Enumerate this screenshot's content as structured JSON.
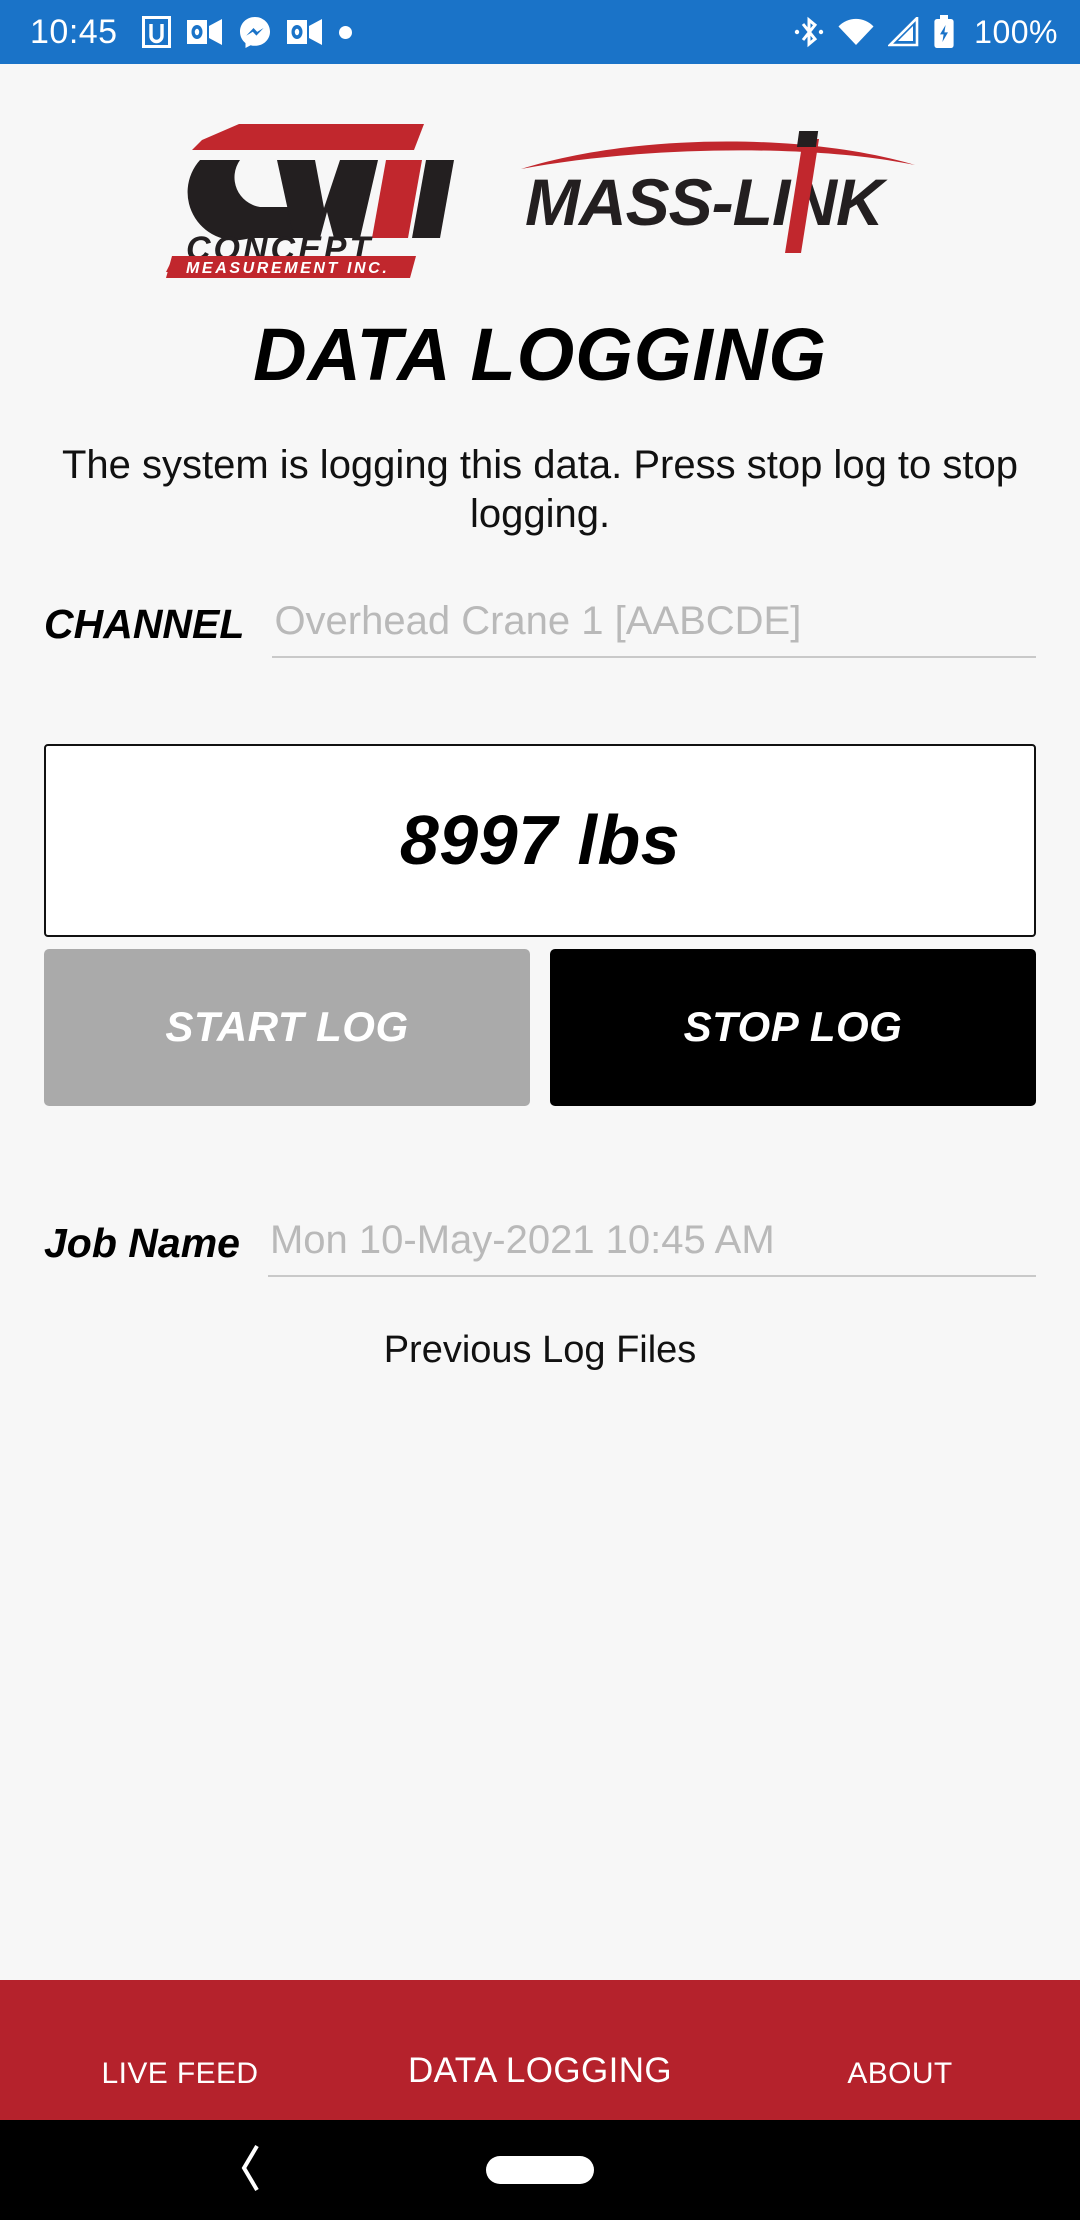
{
  "statusbar": {
    "time": "10:45",
    "battery_text": "100%",
    "left_icons": [
      "u-app-icon",
      "outlook-icon",
      "messenger-icon",
      "outlook-icon",
      "dot-icon"
    ],
    "right_icons": [
      "bluetooth-icon",
      "wifi-icon",
      "cell-signal-icon",
      "battery-charging-icon"
    ],
    "background_color": "#1a73c8"
  },
  "branding": {
    "cmi": {
      "mark": "CMI",
      "name": "CONCEPT",
      "tagline": "MEASUREMENT INC."
    },
    "masslink": {
      "name": "MASS-LINK"
    },
    "accent_red": "#b5222c",
    "dark": "#231f20"
  },
  "header": {
    "title": "DATA LOGGING",
    "description": "The system is logging this data. Press stop log to stop logging."
  },
  "channel": {
    "label": "CHANNEL",
    "value": "",
    "placeholder": "Overhead Crane 1 [AABCDE]"
  },
  "reading": {
    "value": "8997 lbs"
  },
  "controls": {
    "start_label": "START LOG",
    "start_enabled": false,
    "stop_label": "STOP LOG",
    "stop_enabled": true,
    "start_color": "#aaaaaa",
    "stop_color": "#000000"
  },
  "job": {
    "label": "Job Name",
    "value": "",
    "placeholder": "Mon 10-May-2021 10:45 AM"
  },
  "links": {
    "previous_log_files": "Previous Log Files"
  },
  "tabs": [
    {
      "label": "LIVE FEED",
      "active": false
    },
    {
      "label": "DATA LOGGING",
      "active": true
    },
    {
      "label": "ABOUT",
      "active": false
    }
  ],
  "navbar": {
    "back": "back-icon",
    "home": "home-pill-icon"
  }
}
